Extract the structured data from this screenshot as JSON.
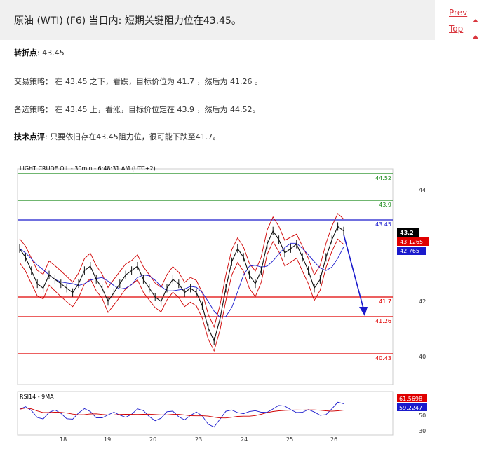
{
  "header": {
    "title": "原油 (WTI) (F6) 当日内: 短期关键阻力位在43.45。"
  },
  "nav": {
    "prev": "Prev",
    "top": "Top"
  },
  "content": {
    "pivot_label": "转折点",
    "pivot_value": ": 43.45",
    "strategy_label": "交易策略",
    "strategy_text": "： 在 43.45 之下，看跌，目标价位为 41.7 ，然后为 41.26 。",
    "alt_label": "备选策略",
    "alt_text": "： 在 43.45 上，看涨，目标价位定在 43.9 ，然后为 44.52。",
    "comment_label": "技术点评",
    "comment_text": ": 只要依旧存在43.45阻力位，很可能下跌至41.7。"
  },
  "chart_data": {
    "type": "line",
    "title": "LIGHT CRUDE OIL - 30min - 6:48:31 AM (UTC+2)",
    "y_ticks": [
      "44",
      "42",
      "40"
    ],
    "x_ticks": [
      "18",
      "19",
      "20",
      "23",
      "24",
      "25",
      "26"
    ],
    "levels": [
      {
        "label": "44.52",
        "value": 44.52,
        "color": "#1a8a1a"
      },
      {
        "label": "43.9",
        "value": 43.9,
        "color": "#1a8a1a"
      },
      {
        "label": "43.45",
        "value": 43.45,
        "color": "#1a1acc"
      },
      {
        "label": "41.7",
        "value": 41.7,
        "color": "#e00000"
      },
      {
        "label": "41.26",
        "value": 41.26,
        "color": "#e00000"
      },
      {
        "label": "40.43",
        "value": 40.43,
        "color": "#e00000"
      }
    ],
    "price_tags": [
      {
        "label": "43.2",
        "value": 43.2,
        "color": "#000000"
      },
      {
        "label": "43.1265",
        "value": 43.1265,
        "color": "#e00000"
      },
      {
        "label": "42.765",
        "value": 42.765,
        "color": "#1a1acc"
      }
    ],
    "rsi": {
      "title": "RSI14 - 9MA",
      "y_ticks": [
        "50",
        "30"
      ],
      "tags": [
        {
          "label": "61.5698",
          "value": 61.5698,
          "color": "#e00000"
        },
        {
          "label": "59.2247",
          "value": 59.2247,
          "color": "#1a1acc"
        }
      ]
    },
    "series": [
      {
        "values": [
          42.8,
          42.6,
          42.3,
          42.0,
          41.9,
          42.2,
          42.1,
          42.0,
          41.9,
          41.8,
          42.0,
          42.3,
          42.4,
          42.1,
          41.9,
          41.6,
          41.8,
          42.0,
          42.2,
          42.3,
          42.4,
          42.1,
          41.9,
          41.7,
          41.6,
          41.9,
          42.1,
          42.0,
          41.8,
          41.9,
          41.8,
          41.5,
          41.0,
          40.7,
          41.2,
          41.9,
          42.5,
          42.8,
          42.6,
          42.2,
          42.0,
          42.3,
          42.9,
          43.2,
          43.0,
          42.7,
          42.8,
          42.9,
          42.6,
          42.3,
          41.9,
          42.1,
          42.6,
          43.0,
          43.3,
          43.2
        ]
      }
    ]
  }
}
